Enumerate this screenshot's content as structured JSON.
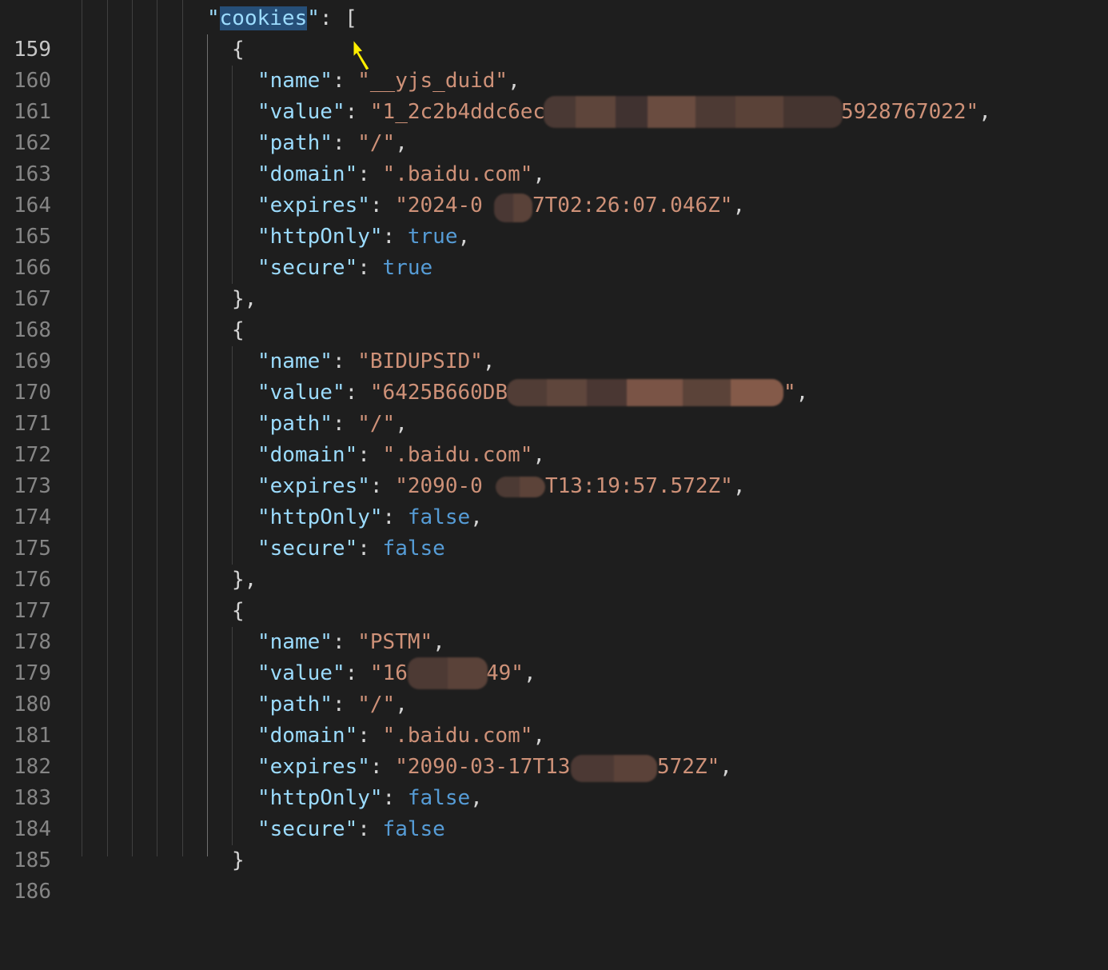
{
  "editor": {
    "colors": {
      "background": "#1e1e1e",
      "key": "#9cdcfe",
      "string": "#ce9178",
      "boolean": "#569cd6",
      "line_number": "#858585",
      "selection": "#264f78"
    },
    "lines": [
      {
        "num": "159",
        "key": "cookies",
        "tail": ": ["
      },
      {
        "num": "160",
        "text": "{"
      },
      {
        "num": "161",
        "key": "name",
        "value": "\"__yjs_duid\"",
        "tail": ","
      },
      {
        "num": "162",
        "key": "value",
        "value_start": "\"1_2c2b4ddc6ec",
        "value_end": "5928767022\"",
        "tail": ","
      },
      {
        "num": "163",
        "key": "path",
        "value": "\"/\"",
        "tail": ","
      },
      {
        "num": "164",
        "key": "domain",
        "value": "\".baidu.com\"",
        "tail": ","
      },
      {
        "num": "165",
        "key": "expires",
        "value_start": "\"2024-0",
        "value_end": "7T02:26:07.046Z\"",
        "tail": ","
      },
      {
        "num": "166",
        "key": "httpOnly",
        "value": "true",
        "tail": ","
      },
      {
        "num": "167",
        "key": "secure",
        "value": "true",
        "tail": ""
      },
      {
        "num": "168",
        "text": "},"
      },
      {
        "num": "169",
        "text": "{"
      },
      {
        "num": "170",
        "key": "name",
        "value": "\"BIDUPSID\"",
        "tail": ","
      },
      {
        "num": "171",
        "key": "value",
        "value_start": "\"6425B660DB",
        "value_end": "\"",
        "tail": ","
      },
      {
        "num": "172",
        "key": "path",
        "value": "\"/\"",
        "tail": ","
      },
      {
        "num": "173",
        "key": "domain",
        "value": "\".baidu.com\"",
        "tail": ","
      },
      {
        "num": "174",
        "key": "expires",
        "value_start": "\"2090-0",
        "value_end": "T13:19:57.572Z\"",
        "tail": ","
      },
      {
        "num": "175",
        "key": "httpOnly",
        "value": "false",
        "tail": ","
      },
      {
        "num": "176",
        "key": "secure",
        "value": "false",
        "tail": ""
      },
      {
        "num": "177",
        "text": "},"
      },
      {
        "num": "178",
        "text": "{"
      },
      {
        "num": "179",
        "key": "name",
        "value": "\"PSTM\"",
        "tail": ","
      },
      {
        "num": "180",
        "key": "value",
        "value_start": "\"16",
        "value_end": "49\"",
        "tail": ","
      },
      {
        "num": "181",
        "key": "path",
        "value": "\"/\"",
        "tail": ","
      },
      {
        "num": "182",
        "key": "domain",
        "value": "\".baidu.com\"",
        "tail": ","
      },
      {
        "num": "183",
        "key": "expires",
        "value_start": "\"2090-03-17T13",
        "value_end": "572Z\"",
        "tail": ","
      },
      {
        "num": "184",
        "key": "httpOnly",
        "value": "false",
        "tail": ","
      },
      {
        "num": "185",
        "key": "secure",
        "value": "false",
        "tail": ""
      },
      {
        "num": "186",
        "text": "}"
      }
    ]
  }
}
